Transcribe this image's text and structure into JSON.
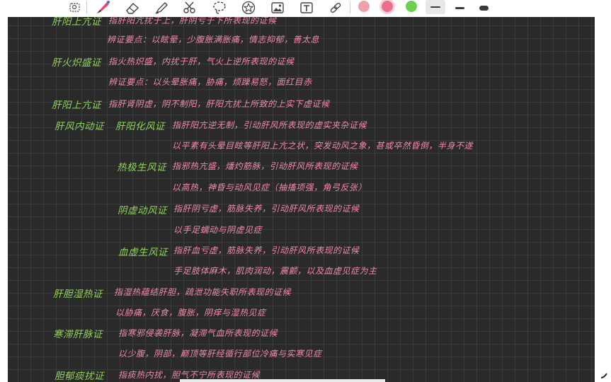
{
  "toolbar": {
    "tools": [
      {
        "name": "lasso-select-icon"
      },
      {
        "name": "pen-icon"
      },
      {
        "name": "eraser-icon"
      },
      {
        "name": "highlighter-icon"
      },
      {
        "name": "scissors-icon"
      },
      {
        "name": "lasso-icon"
      },
      {
        "name": "star-shape-icon"
      },
      {
        "name": "image-icon"
      },
      {
        "name": "text-box-icon"
      },
      {
        "name": "link-icon"
      }
    ],
    "colors": [
      "#f0a0a8",
      "#ee6f8a",
      "#6bd04d"
    ],
    "selected_color": "#ee6f8a"
  },
  "notes": {
    "l1_head": "肝阳上亢证",
    "l1_def": "指肝阳亢扰于上，肝阴亏于下所表现的证候",
    "l2": "辨证要点：以眩晕，少腹胀满胀痛，情志抑郁，善太息",
    "l3_head": "肝火炽盛证",
    "l3_def": "指火热炽盛，内扰于肝，气火上逆所表现的证候",
    "l4": "辨证要点：以头晕胀痛，胁痛，烦躁易怒，面红目赤",
    "l5_head": "肝阳上亢证",
    "l5_def": "指肝肾阴虚，阴不制阳，肝阳亢扰上所致的上实下虚证候",
    "l6_head": "肝风内动证",
    "l6_sub": "肝阳化风证",
    "l6_def": "指肝阳亢逆无制，引动肝风所表现的虚实夹杂证候",
    "l7": "以平素有头晕目眩等肝阳上亢之状，突发动风之象，甚或卒然昏倒，半身不遂",
    "l8_sub": "热极生风证",
    "l8_def": "指邪热亢盛，燔灼筋脉，引动肝风所表现的证候",
    "l9": "以高热，神昏与动风见症（抽搐项强，角弓反张）",
    "l10_sub": "阴虚动风证",
    "l10_def": "指肝阴亏虚，筋脉失养，引动肝风所表现的证候",
    "l11": "以手足蠕动与阴虚见症",
    "l12_sub": "血虚生风证",
    "l12_def": "指肝血亏虚，筋脉失养，引动肝风所表现的证候",
    "l13": "手足肢体麻木，肌肉润动，震颤，以及血虚见症为主",
    "l14_head": "肝胆湿热证",
    "l14_def": "指湿热蕴结肝胆，疏泄功能失职所表现的证候",
    "l15": "以胁痛，厌食，腹胀，阴痒与湿热见症",
    "l16_head": "寒滞肝脉证",
    "l16_def": "指寒邪侵袭肝脉，凝滞气血所表现的证候",
    "l17": "以少腹，阴部，巅顶等肝经循行部位冷痛与实寒见症",
    "l18_head": "胆郁痰扰证",
    "l18_def": "指痰热内扰，胆气不宁所表现的证候"
  }
}
